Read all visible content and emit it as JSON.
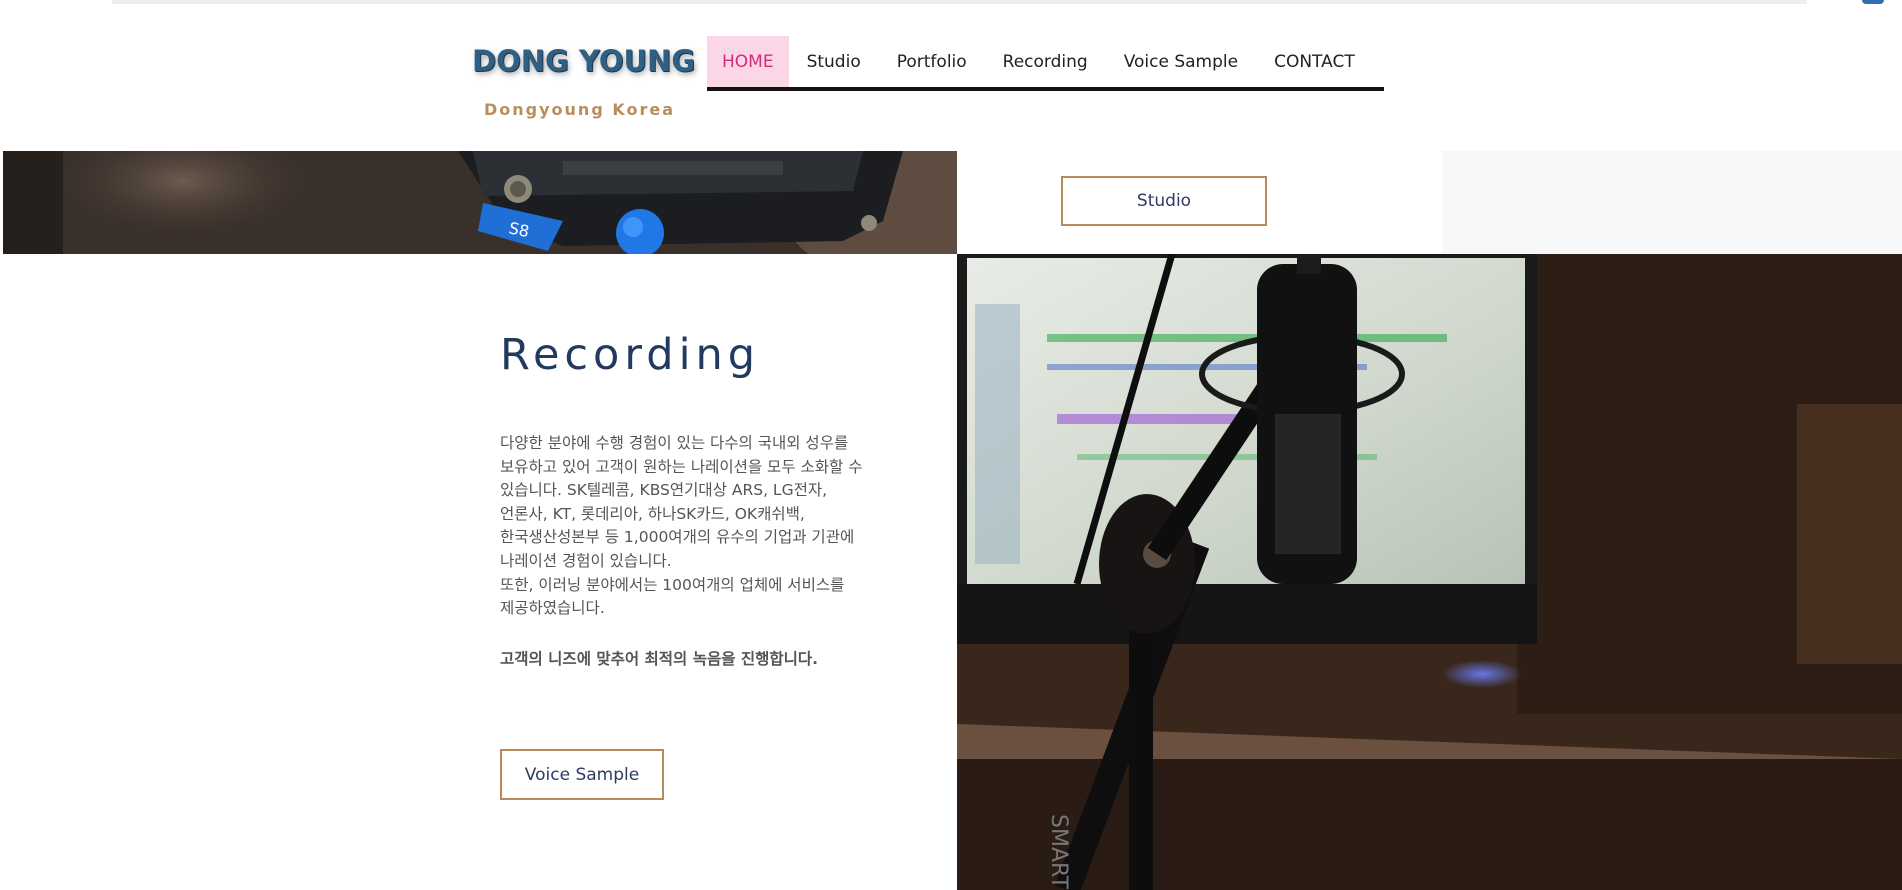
{
  "brand": {
    "logo": "DONG YOUNG",
    "subtitle": "Dongyoung Korea"
  },
  "nav": {
    "items": [
      {
        "label": "HOME",
        "active": true
      },
      {
        "label": "Studio",
        "active": false
      },
      {
        "label": "Portfolio",
        "active": false
      },
      {
        "label": "Recording",
        "active": false
      },
      {
        "label": "Voice Sample",
        "active": false
      },
      {
        "label": "CONTACT",
        "active": false
      }
    ]
  },
  "studio_section": {
    "button_label": "Studio"
  },
  "recording_section": {
    "title": "Recording",
    "body_lines": [
      "다양한 분야에 수행 경험이 있는 다수의 국내외 성우를",
      "보유하고 있어 고객이 원하는 나레이션을 모두 소화할 수",
      "있습니다. SK텔레콤, KBS연기대상 ARS, LG전자,",
      "언론사, KT, 롯데리아, 하나SK카드, OK캐쉬백,",
      "한국생산성본부 등 1,000여개의 유수의 기업과 기관에",
      "나레이션 경험이 있습니다.",
      "또한, 이러닝 분야에서는 100여개의 업체에 서비스를",
      "제공하였습니다."
    ],
    "emphasis": "고객의 니즈에 맞추어 최적의 녹음을 진행합니다.",
    "button_label": "Voice Sample"
  },
  "colors": {
    "accent_pink": "#fbd6e6",
    "accent_pink_text": "#d42a78",
    "button_border": "#b88a5b",
    "title_navy": "#223a5f"
  },
  "icons": {
    "strip_photo": "camera-tripod-photo",
    "main_photo": "studio-microphone-photo"
  }
}
